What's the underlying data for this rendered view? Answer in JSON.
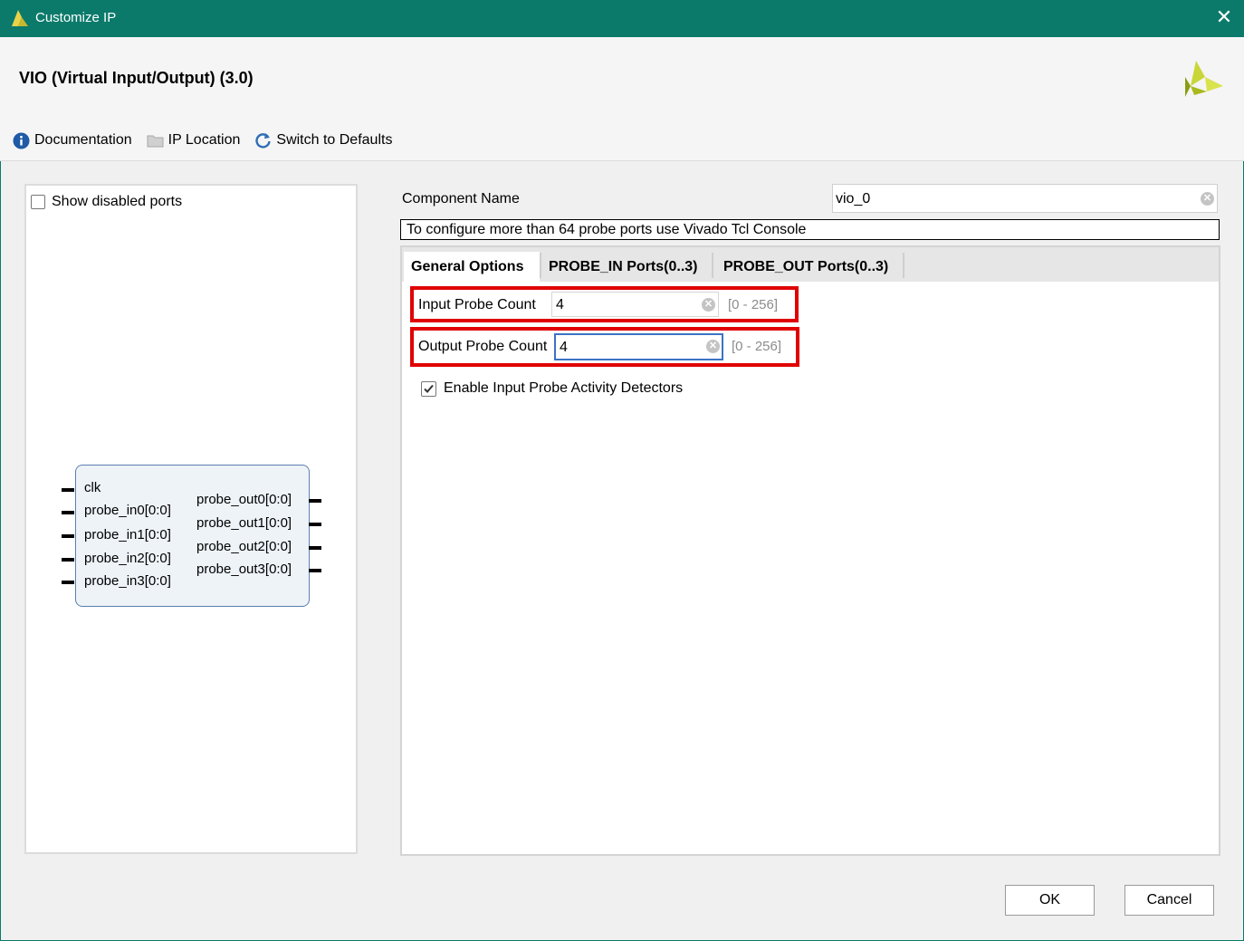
{
  "window": {
    "title": "Customize IP",
    "close_glyph": "✕"
  },
  "header": {
    "ip_title": "VIO (Virtual Input/Output) (3.0)"
  },
  "toolbar": {
    "documentation": "Documentation",
    "ip_location": "IP Location",
    "switch_defaults": "Switch to Defaults"
  },
  "left_panel": {
    "show_disabled_label": "Show disabled ports",
    "show_disabled_checked": false,
    "block": {
      "inputs": [
        "clk",
        "probe_in0[0:0]",
        "probe_in1[0:0]",
        "probe_in2[0:0]",
        "probe_in3[0:0]"
      ],
      "outputs": [
        "probe_out0[0:0]",
        "probe_out1[0:0]",
        "probe_out2[0:0]",
        "probe_out3[0:0]"
      ]
    }
  },
  "component": {
    "label": "Component Name",
    "value": "vio_0"
  },
  "note": "To configure more than 64 probe ports use Vivado Tcl Console",
  "tabs": [
    "General Options",
    "PROBE_IN Ports(0..3)",
    "PROBE_OUT Ports(0..3)"
  ],
  "active_tab": "General Options",
  "general": {
    "input_probe_label": "Input  Probe  Count",
    "input_probe_value": "4",
    "input_probe_range": "[0 - 256]",
    "output_probe_label": "Output Probe Count",
    "output_probe_value": "4",
    "output_probe_range": "[0 - 256]",
    "activity_label": "Enable Input Probe Activity Detectors",
    "activity_checked": true
  },
  "buttons": {
    "ok": "OK",
    "cancel": "Cancel"
  },
  "colors": {
    "titlebar": "#0b7a6b",
    "highlight": "#e00000",
    "accent_blue": "#2f6db5"
  }
}
